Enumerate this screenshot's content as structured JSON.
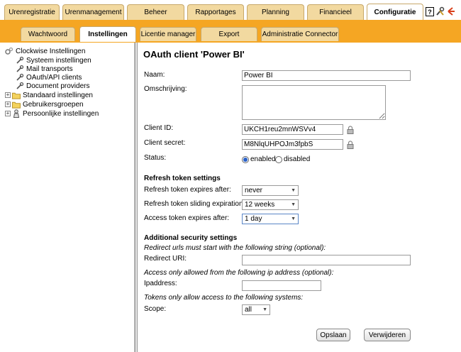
{
  "top_tabs": [
    {
      "label": "Urenregistratie"
    },
    {
      "label": "Urenmanagement"
    },
    {
      "label": "Beheer"
    },
    {
      "label": "Rapportages"
    },
    {
      "label": "Planning"
    },
    {
      "label": "Financieel"
    },
    {
      "label": "Configuratie"
    }
  ],
  "toolbar_icons": [
    "help-icon",
    "tools-icon",
    "logout-icon"
  ],
  "sub_tabs": [
    {
      "label": "Wachtwoord"
    },
    {
      "label": "Instellingen"
    },
    {
      "label": "Licentie manager"
    },
    {
      "label": "Export"
    },
    {
      "label": "Administratie Connector"
    }
  ],
  "tree": {
    "root": "Clockwise Instellingen",
    "items": [
      {
        "label": "Systeem instellingen"
      },
      {
        "label": "Mail transports"
      },
      {
        "label": "OAuth/API clients"
      },
      {
        "label": "Document providers"
      }
    ],
    "groups": [
      {
        "label": "Standaard instellingen"
      },
      {
        "label": "Gebruikersgroepen"
      },
      {
        "label": "Persoonlijke instellingen"
      }
    ]
  },
  "form": {
    "title": "OAuth client 'Power BI'",
    "name_label": "Naam:",
    "name_value": "Power BI",
    "description_label": "Omschrijving:",
    "description_value": "",
    "client_id_label": "Client ID:",
    "client_id_value": "UKCH1reu2mnWSVv4",
    "client_secret_label": "Client secret:",
    "client_secret_value": "M8NlqUHPOJm3fpbS",
    "status_label": "Status:",
    "status_enabled": "enabled",
    "status_disabled": "disabled",
    "refresh_section": "Refresh token settings",
    "refresh_expires_label": "Refresh token expires after:",
    "refresh_expires_value": "never",
    "sliding_label": "Refresh token sliding expiration:",
    "sliding_value": "12 weeks",
    "access_label": "Access token expires after:",
    "access_value": "1 day",
    "security_section": "Additional security settings",
    "redirect_hint": "Redirect urls must start with the following string (optional):",
    "redirect_label": "Redirect URI:",
    "redirect_value": "",
    "ip_hint": "Access only allowed from the following ip address (optional):",
    "ip_label": "Ipaddress:",
    "ip_value": "",
    "systems_hint": "Tokens only allow access to the following systems:",
    "scope_label": "Scope:",
    "scope_value": "all",
    "save_label": "Opslaan",
    "delete_label": "Verwijderen"
  }
}
